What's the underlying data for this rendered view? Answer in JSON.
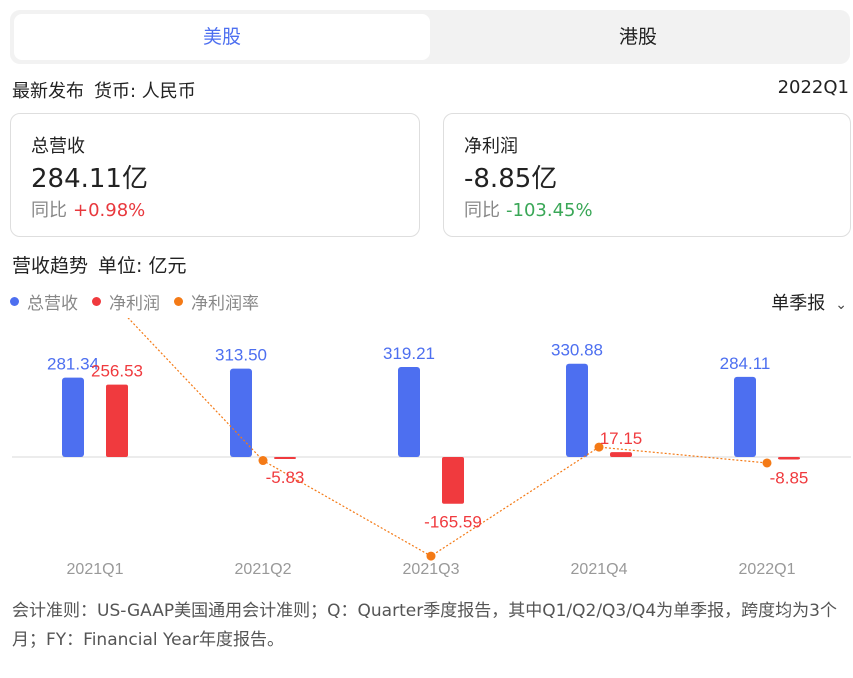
{
  "tabs": [
    {
      "label": "美股",
      "active": true
    },
    {
      "label": "港股",
      "active": false
    }
  ],
  "meta": {
    "latest": "最新发布",
    "currency": "货币: 人民币",
    "period": "2022Q1"
  },
  "cards": {
    "revenue": {
      "label": "总营收",
      "value": "284.11亿",
      "yoy_label": "同比",
      "yoy": "+0.98%"
    },
    "net_income": {
      "label": "净利润",
      "value": "-8.85亿",
      "yoy_label": "同比",
      "yoy": "-103.45%"
    }
  },
  "trend": {
    "title": "营收趋势",
    "unit": "单位: 亿元",
    "period_selector": "单季报",
    "legend": [
      "总营收",
      "净利润",
      "净利润率"
    ]
  },
  "colors": {
    "revenue": "#4d6ff0",
    "net_income": "#f03a3e",
    "margin": "#f47a16",
    "accent": "#4d6ff0",
    "positive": "#e8383d",
    "negative": "#3aa757"
  },
  "chart_data": {
    "type": "bar",
    "categories": [
      "2021Q1",
      "2021Q2",
      "2021Q3",
      "2021Q4",
      "2022Q1"
    ],
    "series": [
      {
        "name": "总营收",
        "values": [
          281.34,
          313.5,
          319.21,
          330.88,
          284.11
        ],
        "labels": [
          "281.34",
          "313.50",
          "319.21",
          "330.88",
          "284.11"
        ]
      },
      {
        "name": "净利润",
        "values": [
          256.53,
          -5.83,
          -165.59,
          17.15,
          -8.85
        ],
        "labels": [
          "256.53",
          "-5.83",
          "-165.59",
          "17.15",
          "-8.85"
        ]
      },
      {
        "name": "净利润率",
        "type": "line",
        "values": [
          91.18,
          -1.86,
          -51.87,
          5.18,
          -3.11
        ]
      }
    ],
    "legend_position": "top-left"
  },
  "footnote": "会计准则：US-GAAP美国通用会计准则；Q：Quarter季度报告，其中Q1/Q2/Q3/Q4为单季报，跨度均为3个月；FY：Financial Year年度报告。"
}
